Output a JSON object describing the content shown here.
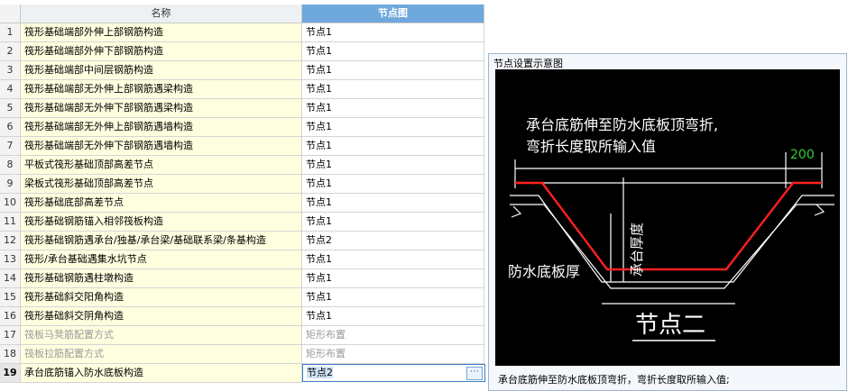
{
  "grid": {
    "header": {
      "name": "名称",
      "node": "节点图"
    },
    "rows": [
      {
        "num": "1",
        "name": "筏形基础端部外伸上部钢筋构造",
        "node": "节点1"
      },
      {
        "num": "2",
        "name": "筏形基础端部外伸下部钢筋构造",
        "node": "节点1"
      },
      {
        "num": "3",
        "name": "筏形基础端部中间层钢筋构造",
        "node": "节点1"
      },
      {
        "num": "4",
        "name": "筏形基础端部无外伸上部钢筋遇梁构造",
        "node": "节点1"
      },
      {
        "num": "5",
        "name": "筏形基础端部无外伸下部钢筋遇梁构造",
        "node": "节点1"
      },
      {
        "num": "6",
        "name": "筏形基础端部无外伸上部钢筋遇墙构造",
        "node": "节点1"
      },
      {
        "num": "7",
        "name": "筏形基础端部无外伸下部钢筋遇墙构造",
        "node": "节点1"
      },
      {
        "num": "8",
        "name": "平板式筏形基础顶部高差节点",
        "node": "节点1"
      },
      {
        "num": "9",
        "name": "梁板式筏形基础顶部高差节点",
        "node": "节点1"
      },
      {
        "num": "10",
        "name": "筏形基础底部高差节点",
        "node": "节点1"
      },
      {
        "num": "11",
        "name": "筏形基础钢筋锚入相邻筏板构造",
        "node": "节点1"
      },
      {
        "num": "12",
        "name": "筏形基础钢筋遇承台/独基/承台梁/基础联系梁/条基构造",
        "node": "节点2"
      },
      {
        "num": "13",
        "name": "筏形/承台基础遇集水坑节点",
        "node": "节点1"
      },
      {
        "num": "14",
        "name": "筏形基础钢筋遇柱墩构造",
        "node": "节点1"
      },
      {
        "num": "15",
        "name": "筏形基础斜交阳角构造",
        "node": "节点1"
      },
      {
        "num": "16",
        "name": "筏形基础斜交阴角构造",
        "node": "节点1"
      },
      {
        "num": "17",
        "name": "筏板马凳筋配置方式",
        "node": "矩形布置",
        "dim": true
      },
      {
        "num": "18",
        "name": "筏板拉筋配置方式",
        "node": "矩形布置",
        "dim": true
      },
      {
        "num": "19",
        "name": "承台底筋锚入防水底板构造",
        "node": "节点2",
        "selected": true
      }
    ]
  },
  "panel": {
    "title": "节点设置示意图",
    "caption": "承台底筋伸至防水底板顶弯折，弯折长度取所输入值;",
    "diagram": {
      "note_line1": "承台底筋伸至防水底板顶弯折,",
      "note_line2": "弯折长度取所输入值",
      "dimension": "200",
      "label_waterproof": "防水底板厚",
      "label_thickness": "承台厚度",
      "node_title": "节点二"
    }
  },
  "colors": {
    "header_active": "#6fa8dc",
    "name_bg": "#ffffe0",
    "rebar": "#ff2020",
    "dim_text": "#33cc33"
  }
}
